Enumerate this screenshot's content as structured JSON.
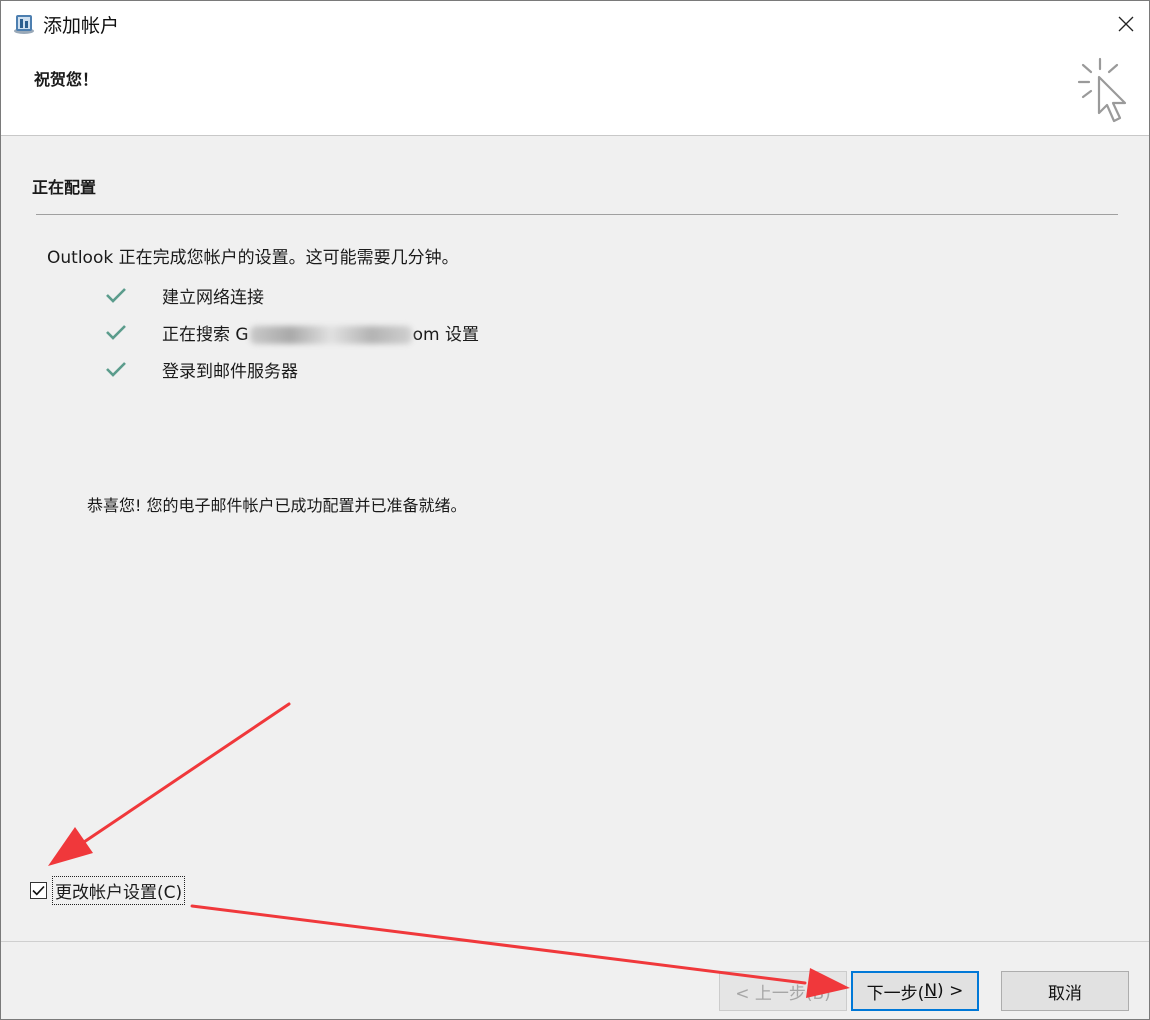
{
  "window": {
    "title": "添加帐户"
  },
  "header": {
    "title": "祝贺您！"
  },
  "section": {
    "title": "正在配置"
  },
  "intro": "Outlook 正在完成您帐户的设置。这可能需要几分钟。",
  "steps": {
    "network": "建立网络连接",
    "search_prefix": "正在搜索 G",
    "search_suffix": "om 设置",
    "login": "登录到邮件服务器"
  },
  "congrats": "恭喜您! 您的电子邮件帐户已成功配置并已准备就绪。",
  "change_settings": {
    "label": "更改帐户设置(C)",
    "checked": true
  },
  "buttons": {
    "back_label": "< 上一步(B)",
    "next_prefix": "下一步(",
    "next_key": "N",
    "next_suffix": ") >",
    "cancel_label": "取消"
  },
  "colors": {
    "check": "#5b9c8c",
    "accent": "#0078d7",
    "arrow": "#f0383b"
  }
}
